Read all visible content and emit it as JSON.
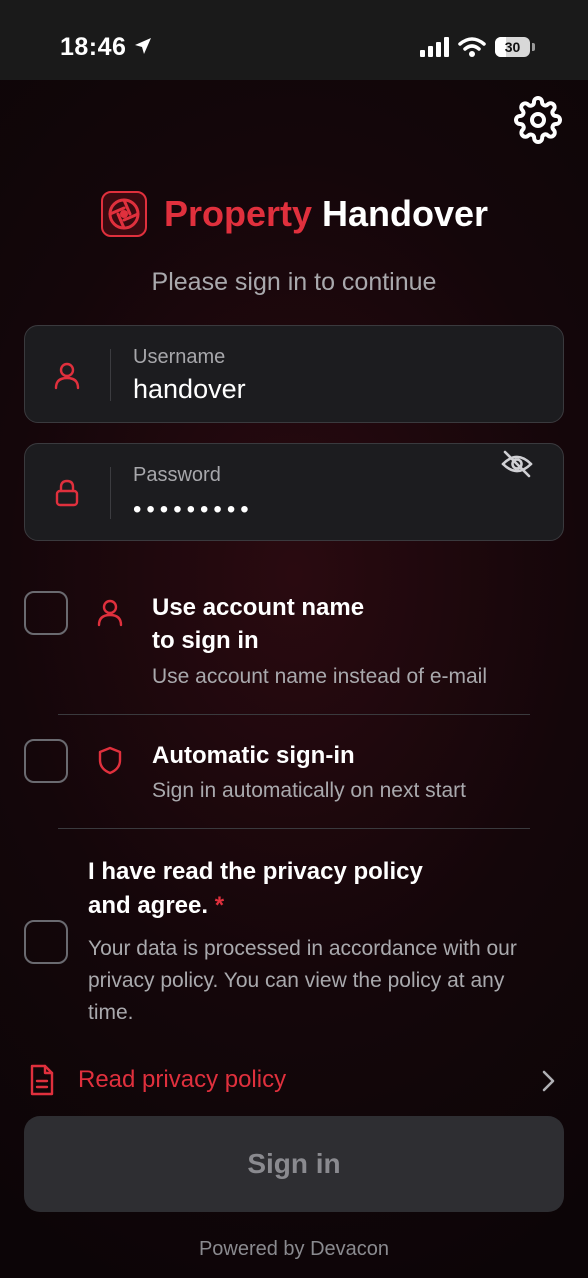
{
  "status_bar": {
    "time": "18:46",
    "battery": "30",
    "battery_level": 0.3,
    "icons": [
      "location-arrow-icon",
      "cellular-signal-icon",
      "wifi-icon",
      "battery-icon"
    ]
  },
  "header": {
    "settings_icon": "gear-icon",
    "logo_icon": "aperture-logo-icon",
    "title_accent": "Property",
    "title_rest": "Handover",
    "subtitle": "Please sign in to continue"
  },
  "form": {
    "username": {
      "label": "Username",
      "value": "handover",
      "icon": "user-icon"
    },
    "password": {
      "label": "Password",
      "masked_value": "•••••••••",
      "icon": "lock-icon",
      "toggle_icon": "eye-off-icon"
    }
  },
  "options": [
    {
      "title_line1": "Use account name",
      "title_line2": "to sign in",
      "description": "Use account name instead of e-mail",
      "icon": "user-icon",
      "checked": false
    },
    {
      "title": "Automatic sign-in",
      "description": "Sign in automatically on next start",
      "icon": "shield-icon",
      "checked": false
    }
  ],
  "privacy": {
    "title_line1": "I have read the privacy policy",
    "title_line2": "and agree.",
    "required_mark": "*",
    "description": "Your data is processed in accordance with our privacy policy. You can view the policy at any time.",
    "checked": false,
    "read_link": "Read privacy policy",
    "link_icon": "document-icon",
    "chevron_icon": "chevron-right-icon"
  },
  "signin_button": "Sign in",
  "footer": "Powered by Devacon",
  "colors": {
    "accent": "#e0303d",
    "field_bg": "#1c1c1f",
    "button_bg": "#2e2e32"
  }
}
